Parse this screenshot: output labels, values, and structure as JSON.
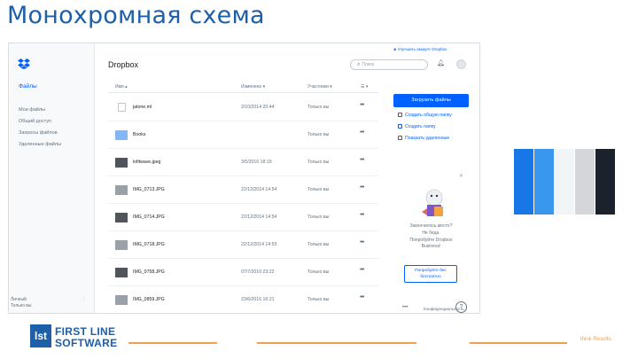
{
  "slide": {
    "title": "Монохромная схема",
    "footer_tagline": "think Results."
  },
  "brand": {
    "logo_short": "lst",
    "name_line1": "FIRST LINE",
    "name_line2": "SOFTWARE"
  },
  "colors": {
    "brand_blue": "#1d5fa8",
    "dropbox_blue": "#0061fe",
    "accent_orange": "#f0a050"
  },
  "swatches": [
    "#1877e6",
    "#3a97ee",
    "#f2f5f8",
    "#d4d6d9",
    "#1b222b"
  ],
  "dropbox": {
    "sidebar": {
      "heading": "Файлы",
      "items": [
        "Мои файлы",
        "Общий доступ",
        "Запросы файлов",
        "Удаленные файлы"
      ],
      "footer_line1": "Личный",
      "footer_line2": "Только вы"
    },
    "header": {
      "title": "Dropbox",
      "search_placeholder": "Поиск",
      "upgrade_link": "Улучшить аккаунт Dropbox"
    },
    "columns": {
      "name": "Имя",
      "modified": "Изменено",
      "members": "Участники",
      "actions": ""
    },
    "rows": [
      {
        "icon": "file-icon",
        "name": "jatone.ml",
        "date": "2/10/2014 20:44",
        "members": "Только вы"
      },
      {
        "icon": "folder-icon",
        "name": "Books",
        "date": "",
        "members": "Только вы"
      },
      {
        "icon": "photo-icon",
        "name": "lofitwave.jpeg",
        "date": "3/5/2016 18:19",
        "members": "Только вы"
      },
      {
        "icon": "photo-icon",
        "name": "IMG_0713.JPG",
        "date": "22/12/2014 14:54",
        "members": "Только вы"
      },
      {
        "icon": "photo-icon",
        "name": "IMG_0714.JPG",
        "date": "22/12/2014 14:54",
        "members": "Только вы"
      },
      {
        "icon": "photo-icon",
        "name": "IMG_0718.JPG",
        "date": "22/12/2014 14:53",
        "members": "Только вы"
      },
      {
        "icon": "photo-icon",
        "name": "IMG_0758.JPG",
        "date": "07/7/2010 23:22",
        "members": "Только вы"
      },
      {
        "icon": "photo-icon",
        "name": "IMG_0859.JPG",
        "date": "23/6/2016 16:21",
        "members": "Только вы"
      }
    ],
    "more_label": "•••",
    "right_panel": {
      "upload_button": "Загрузить файлы",
      "actions": [
        "Создать общую папку",
        "Создать папку",
        "Показать удаленные"
      ],
      "promo_text": [
        "Закончилось место?",
        "Не беда.",
        "Попробуйте Dropbox",
        "Business!"
      ],
      "promo_button_line1": "Попробуйте бес",
      "promo_button_line2": "бесплатно",
      "privacy": "Конфиденциальность"
    }
  }
}
